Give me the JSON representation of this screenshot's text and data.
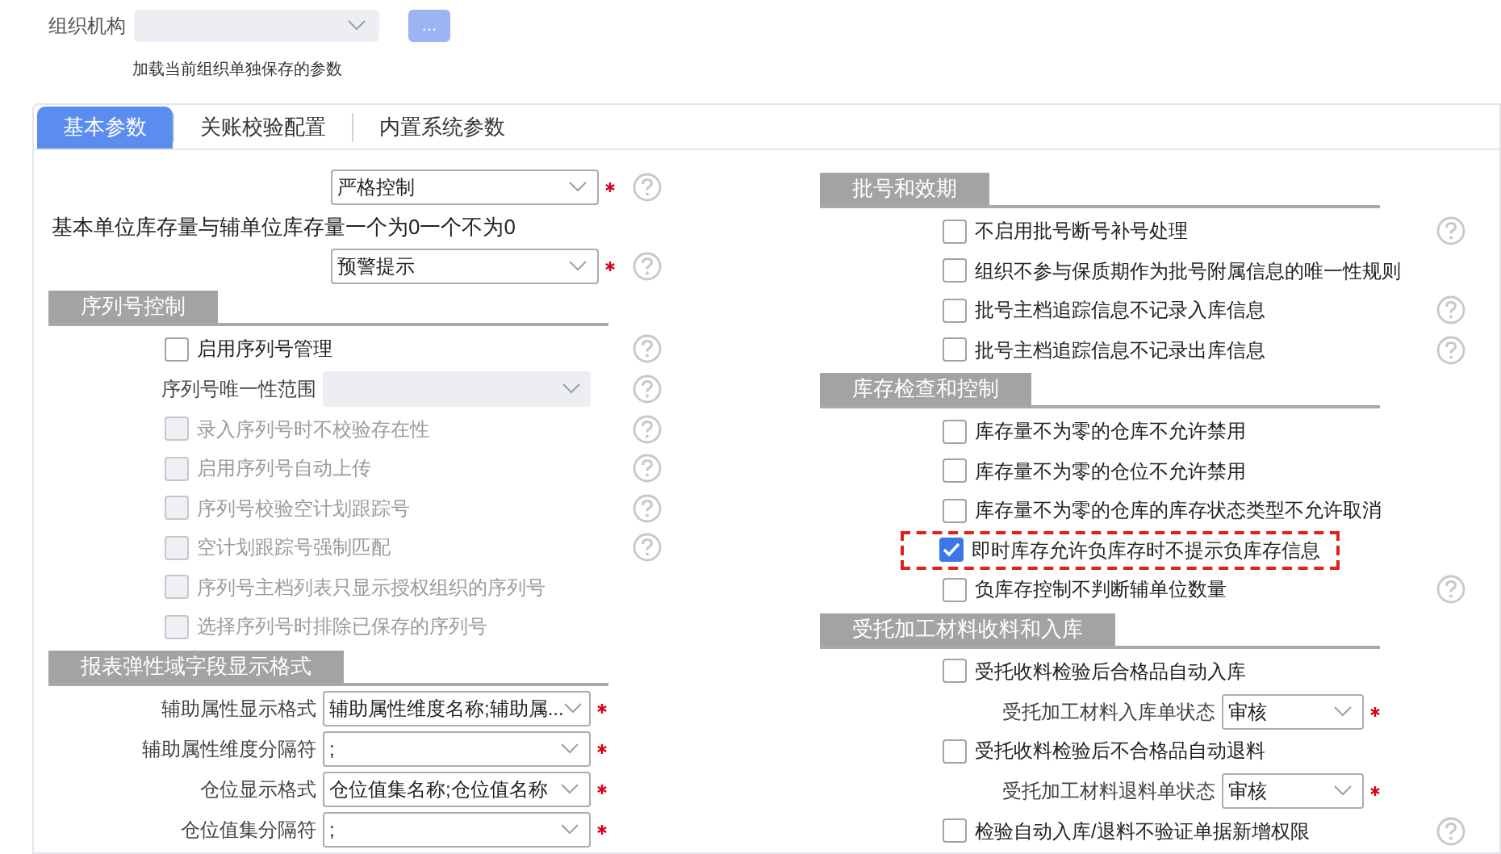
{
  "org_selector": {
    "label": "组织机构",
    "disabled": true,
    "button": "...",
    "hint": "加载当前组织单独保存的参数"
  },
  "tabs": [
    {
      "label": "基本参数",
      "selected": true
    },
    {
      "label": "关账校验配置",
      "selected": false
    },
    {
      "label": "内置系统参数",
      "selected": false
    }
  ],
  "left_panel": [
    {
      "kind": "select",
      "value": "严格控制",
      "required": true,
      "help": true,
      "disabled": false
    },
    {
      "kind": "text",
      "text": "基本单位库存量与辅单位库存量一个为0一个不为0"
    },
    {
      "kind": "select",
      "value": "预警提示",
      "required": true,
      "help": true,
      "disabled": false
    },
    {
      "kind": "section",
      "title": "序列号控制"
    },
    {
      "kind": "checkbox",
      "label": "启用序列号管理",
      "checked": false,
      "disabled": false,
      "help": true
    },
    {
      "kind": "field",
      "label": "序列号唯一性范围",
      "required": false,
      "help": true,
      "disabled": true
    },
    {
      "kind": "checkbox",
      "label": "录入序列号时不校验存在性",
      "checked": false,
      "disabled": true,
      "help": true
    },
    {
      "kind": "checkbox",
      "label": "启用序列号自动上传",
      "checked": false,
      "disabled": true,
      "help": true
    },
    {
      "kind": "checkbox",
      "label": "序列号校验空计划跟踪号",
      "checked": false,
      "disabled": true,
      "help": true
    },
    {
      "kind": "checkbox",
      "label": "空计划跟踪号强制匹配",
      "checked": false,
      "disabled": true,
      "help": true
    },
    {
      "kind": "checkbox",
      "label": "序列号主档列表只显示授权组织的序列号",
      "checked": false,
      "disabled": true,
      "help": false
    },
    {
      "kind": "checkbox",
      "label": "选择序列号时排除已保存的序列号",
      "checked": false,
      "disabled": true,
      "help": false
    },
    {
      "kind": "section",
      "title": "报表弹性域字段显示格式"
    },
    {
      "kind": "field",
      "label": "辅助属性显示格式",
      "value": "辅助属性维度名称;辅助属...",
      "required": true,
      "help": false,
      "disabled": false
    },
    {
      "kind": "field",
      "label": "辅助属性维度分隔符",
      "value": ";",
      "required": true,
      "help": false,
      "disabled": false
    },
    {
      "kind": "field",
      "label": "仓位显示格式",
      "value": "仓位值集名称;仓位值名称",
      "required": true,
      "help": false,
      "disabled": false
    },
    {
      "kind": "field",
      "label": "仓位值集分隔符",
      "value": ";",
      "required": true,
      "help": false,
      "disabled": false
    }
  ],
  "right_panel": [
    {
      "kind": "section",
      "title": "批号和效期"
    },
    {
      "kind": "checkbox",
      "label": "不启用批号断号补号处理",
      "checked": false,
      "disabled": false,
      "help": true,
      "highlighted": false
    },
    {
      "kind": "checkbox",
      "label": "组织不参与保质期作为批号附属信息的唯一性规则",
      "checked": false,
      "disabled": false,
      "help": false,
      "highlighted": false
    },
    {
      "kind": "checkbox",
      "label": "批号主档追踪信息不记录入库信息",
      "checked": false,
      "disabled": false,
      "help": true,
      "highlighted": false
    },
    {
      "kind": "checkbox",
      "label": "批号主档追踪信息不记录出库信息",
      "checked": false,
      "disabled": false,
      "help": true,
      "highlighted": false
    },
    {
      "kind": "section",
      "title": "库存检查和控制"
    },
    {
      "kind": "checkbox",
      "label": "库存量不为零的仓库不允许禁用",
      "checked": false,
      "disabled": false,
      "help": false,
      "highlighted": false
    },
    {
      "kind": "checkbox",
      "label": "库存量不为零的仓位不允许禁用",
      "checked": false,
      "disabled": false,
      "help": false,
      "highlighted": false
    },
    {
      "kind": "checkbox",
      "label": "库存量不为零的仓库的库存状态类型不允许取消",
      "checked": false,
      "disabled": false,
      "help": false,
      "highlighted": false
    },
    {
      "kind": "checkbox",
      "label": "即时库存允许负库存时不提示负库存信息",
      "checked": true,
      "disabled": false,
      "help": false,
      "highlighted": true
    },
    {
      "kind": "checkbox",
      "label": "负库存控制不判断辅单位数量",
      "checked": false,
      "disabled": false,
      "help": true,
      "highlighted": false
    },
    {
      "kind": "section",
      "title": "受托加工材料收料和入库"
    },
    {
      "kind": "checkbox",
      "label": "受托收料检验后合格品自动入库",
      "checked": false,
      "disabled": false,
      "help": false,
      "highlighted": false
    },
    {
      "kind": "field",
      "label": "受托加工材料入库单状态",
      "value": "审核",
      "required": true,
      "help": false,
      "disabled": false
    },
    {
      "kind": "checkbox",
      "label": "受托收料检验后不合格品自动退料",
      "checked": false,
      "disabled": false,
      "help": false,
      "highlighted": false
    },
    {
      "kind": "field",
      "label": "受托加工材料退料单状态",
      "value": "审核",
      "required": true,
      "help": false,
      "disabled": false
    },
    {
      "kind": "checkbox",
      "label": "检验自动入库/退料不验证单据新增权限",
      "checked": false,
      "disabled": false,
      "help": true,
      "highlighted": false
    }
  ]
}
